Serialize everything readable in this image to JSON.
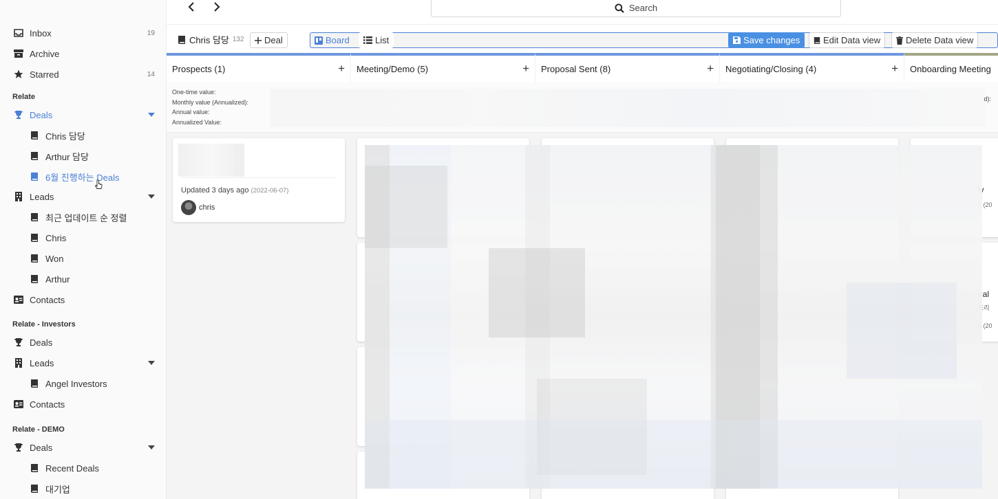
{
  "sidebar": {
    "inbox": {
      "label": "Inbox",
      "count": "19"
    },
    "archive": {
      "label": "Archive"
    },
    "starred": {
      "label": "Starred",
      "count": "14"
    },
    "sections": [
      {
        "heading": "Relate",
        "deals": {
          "label": "Deals",
          "items": [
            "Chris 담당",
            "Arthur 담당",
            "6월 진행하는 Deals"
          ]
        },
        "leads": {
          "label": "Leads",
          "items": [
            "최근 업데이트 순 정렬",
            "Chris",
            "Won",
            "Arthur"
          ]
        },
        "contacts": {
          "label": "Contacts"
        }
      },
      {
        "heading": "Relate - Investors",
        "deals": {
          "label": "Deals"
        },
        "leads": {
          "label": "Leads",
          "items": [
            "Angel Investors"
          ]
        },
        "contacts": {
          "label": "Contacts"
        }
      },
      {
        "heading": "Relate - DEMO",
        "deals": {
          "label": "Deals",
          "items": [
            "Recent Deals",
            "대기업"
          ]
        }
      }
    ],
    "active_item": "6월 진행하는 Deals"
  },
  "topbar": {
    "search_label": "Search"
  },
  "toolbar": {
    "view_title": "Chris 담당",
    "view_count": "132",
    "add_deal": "Deal",
    "board": "Board",
    "list": "List",
    "save": "Save changes",
    "edit": "Edit Data view",
    "delete": "Delete Data view"
  },
  "board": {
    "columns": [
      {
        "title": "Prospects (1)"
      },
      {
        "title": "Meeting/Demo (5)"
      },
      {
        "title": "Proposal Sent (8)"
      },
      {
        "title": "Negotiating/Closing (4)"
      },
      {
        "title": "Onboarding Meeting"
      }
    ],
    "summary_labels": [
      "One-time value:",
      "Monthly value (Annualized):",
      "Annual value:",
      "Annualized Value:"
    ],
    "summary_fragment": "d):",
    "cards": [
      {
        "updated": "Updated 3 days ago",
        "date": "(2022-06-07)",
        "owner": "chris"
      }
    ],
    "peek_fragments": [
      "ly",
      "o (20",
      "ual",
      "드리",
      "o (20"
    ]
  },
  "colors": {
    "accent": "#4a80d6",
    "column_border": "#6f97df",
    "onboarding_border": "#a3a786",
    "primary_button": "#4a90e2"
  }
}
